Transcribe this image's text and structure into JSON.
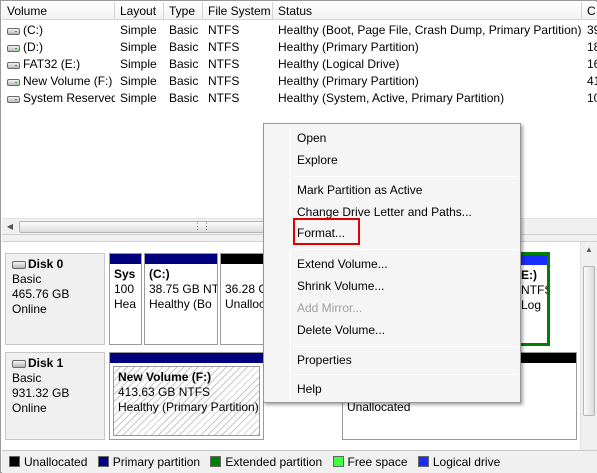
{
  "columns": [
    "Volume",
    "Layout",
    "Type",
    "File System",
    "Status",
    "C"
  ],
  "volumes": [
    {
      "name": "(C:)",
      "layout": "Simple",
      "type": "Basic",
      "fs": "NTFS",
      "status": "Healthy (Boot, Page File, Crash Dump, Primary Partition)",
      "cap": "39"
    },
    {
      "name": "(D:)",
      "layout": "Simple",
      "type": "Basic",
      "fs": "NTFS",
      "status": "Healthy (Primary Partition)",
      "cap": "18"
    },
    {
      "name": "FAT32 (E:)",
      "layout": "Simple",
      "type": "Basic",
      "fs": "NTFS",
      "status": "Healthy (Logical Drive)",
      "cap": "16"
    },
    {
      "name": "New Volume (F:)",
      "layout": "Simple",
      "type": "Basic",
      "fs": "NTFS",
      "status": "Healthy (Primary Partition)",
      "cap": "41"
    },
    {
      "name": "System Reserved",
      "layout": "Simple",
      "type": "Basic",
      "fs": "NTFS",
      "status": "Healthy (System, Active, Primary Partition)",
      "cap": "10"
    }
  ],
  "disks": [
    {
      "name": "Disk 0",
      "type": "Basic",
      "size": "465.76 GB",
      "state": "Online"
    },
    {
      "name": "Disk 1",
      "type": "Basic",
      "size": "931.32 GB",
      "state": "Online"
    }
  ],
  "partitions": {
    "sys": {
      "l1": "Sys",
      "l2": "100",
      "l3": "Hea"
    },
    "c": {
      "l1": "(C:)",
      "l2": "38.75 GB NT",
      "l3": "Healthy (Bo"
    },
    "unalloc0": {
      "l2": "36.28 G",
      "l3": "Unalloc"
    },
    "e": {
      "l1": "E:)",
      "l2": "NTFS",
      "l3": "Log"
    },
    "f": {
      "l1": "New Volume  (F:)",
      "l2": "413.63 GB NTFS",
      "l3": "Healthy (Primary Partition)"
    },
    "unalloc1": {
      "l3": "Unallocated"
    }
  },
  "menu": {
    "open": "Open",
    "explore": "Explore",
    "mark_active": "Mark Partition as Active",
    "change_letter": "Change Drive Letter and Paths...",
    "format": "Format...",
    "extend": "Extend Volume...",
    "shrink": "Shrink Volume...",
    "mirror": "Add Mirror...",
    "delete": "Delete Volume...",
    "properties": "Properties",
    "help": "Help"
  },
  "legend": [
    {
      "label": "Unallocated",
      "color": "#000000"
    },
    {
      "label": "Primary partition",
      "color": "#00007f"
    },
    {
      "label": "Extended partition",
      "color": "#008000"
    },
    {
      "label": "Free space",
      "color": "#40ff40"
    },
    {
      "label": "Logical drive",
      "color": "#1a2cff"
    }
  ],
  "colors": {
    "primary": "#00007f",
    "extended": "#008000",
    "logical": "#1a2cff",
    "unallocated": "#000000",
    "highlight": "#e00000"
  }
}
